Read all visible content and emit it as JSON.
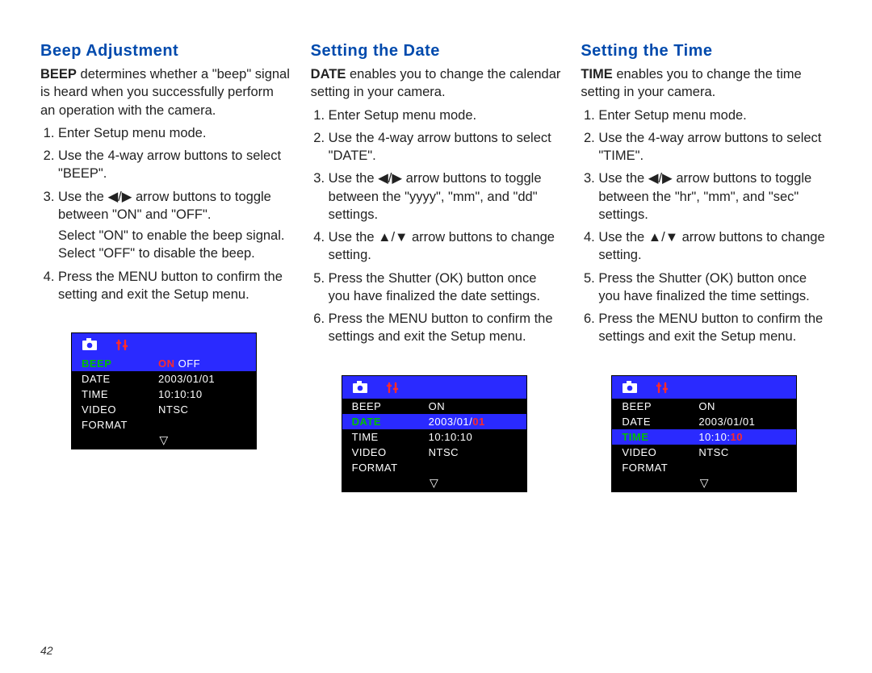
{
  "page_number": "42",
  "columns": [
    {
      "heading": "Beep Adjustment",
      "intro_bold": "BEEP",
      "intro_rest": " determines whether a \"beep\" signal is heard when you successfully perform an operation with the camera.",
      "steps": [
        {
          "text": "Enter Setup menu mode."
        },
        {
          "text": "Use the 4-way arrow buttons to select \"BEEP\"."
        },
        {
          "text_pre": "Use the ",
          "arrows": "◀/▶",
          "text_post": " arrow buttons to toggle between \"ON\" and \"OFF\".",
          "note": "Select \"ON\" to enable the beep signal. Select \"OFF\" to disable the beep."
        },
        {
          "text": "Press the MENU button to confirm the setting and exit the Setup menu."
        }
      ],
      "cam": {
        "rows": [
          {
            "label": "BEEP",
            "value_pre": "",
            "value_hl": "ON",
            "value_sep": "  ",
            "value_post": "OFF",
            "highlight": true,
            "label_green": true,
            "hl_is_red": true
          },
          {
            "label": "DATE",
            "value": "2003/01/01"
          },
          {
            "label": "TIME",
            "value": "10:10:10"
          },
          {
            "label": "VIDEO",
            "value": "NTSC"
          },
          {
            "label": "FORMAT",
            "value": ""
          }
        ]
      }
    },
    {
      "heading": "Setting the Date",
      "intro_bold": "DATE",
      "intro_rest": " enables you to change the calendar setting in your camera.",
      "steps": [
        {
          "text": "Enter Setup menu mode."
        },
        {
          "text": "Use the 4-way arrow buttons to select \"DATE\"."
        },
        {
          "text_pre": "Use the ",
          "arrows": "◀/▶",
          "text_post": " arrow buttons to toggle between the \"yyyy\", \"mm\", and \"dd\" settings."
        },
        {
          "text_pre": "Use the ",
          "arrows": "▲/▼",
          "text_post": " arrow buttons to change setting."
        },
        {
          "text": "Press the Shutter (OK) button once you have finalized the date settings."
        },
        {
          "text": "Press the MENU button to confirm the settings and exit the Setup menu."
        }
      ],
      "cam": {
        "rows": [
          {
            "label": "BEEP",
            "value": "ON"
          },
          {
            "label": "DATE",
            "value_pre": "2003/01/",
            "value_hl": "01",
            "highlight": true,
            "label_green": true,
            "hl_is_red": true
          },
          {
            "label": "TIME",
            "value": "10:10:10"
          },
          {
            "label": "VIDEO",
            "value": "NTSC"
          },
          {
            "label": "FORMAT",
            "value": ""
          }
        ]
      }
    },
    {
      "heading": "Setting the Time",
      "intro_bold": "TIME",
      "intro_rest": " enables you to change the time setting in your camera.",
      "steps": [
        {
          "text": "Enter Setup menu mode."
        },
        {
          "text": "Use the 4-way arrow buttons to select \"TIME\"."
        },
        {
          "text_pre": "Use the ",
          "arrows": "◀/▶",
          "text_post": " arrow buttons to toggle between the \"hr\", \"mm\", and \"sec\" settings."
        },
        {
          "text_pre": "Use the ",
          "arrows": "▲/▼",
          "text_post": " arrow buttons to change setting."
        },
        {
          "text": "Press the Shutter (OK) button once you have finalized the time settings."
        },
        {
          "text": "Press the MENU button to confirm the settings and exit the Setup menu."
        }
      ],
      "cam": {
        "rows": [
          {
            "label": "BEEP",
            "value": "ON"
          },
          {
            "label": "DATE",
            "value": "2003/01/01"
          },
          {
            "label": "TIME",
            "value_pre": "10:10:",
            "value_hl": "10",
            "highlight": true,
            "label_green": true,
            "hl_is_red": true
          },
          {
            "label": "VIDEO",
            "value": "NTSC"
          },
          {
            "label": "FORMAT",
            "value": ""
          }
        ]
      }
    }
  ]
}
